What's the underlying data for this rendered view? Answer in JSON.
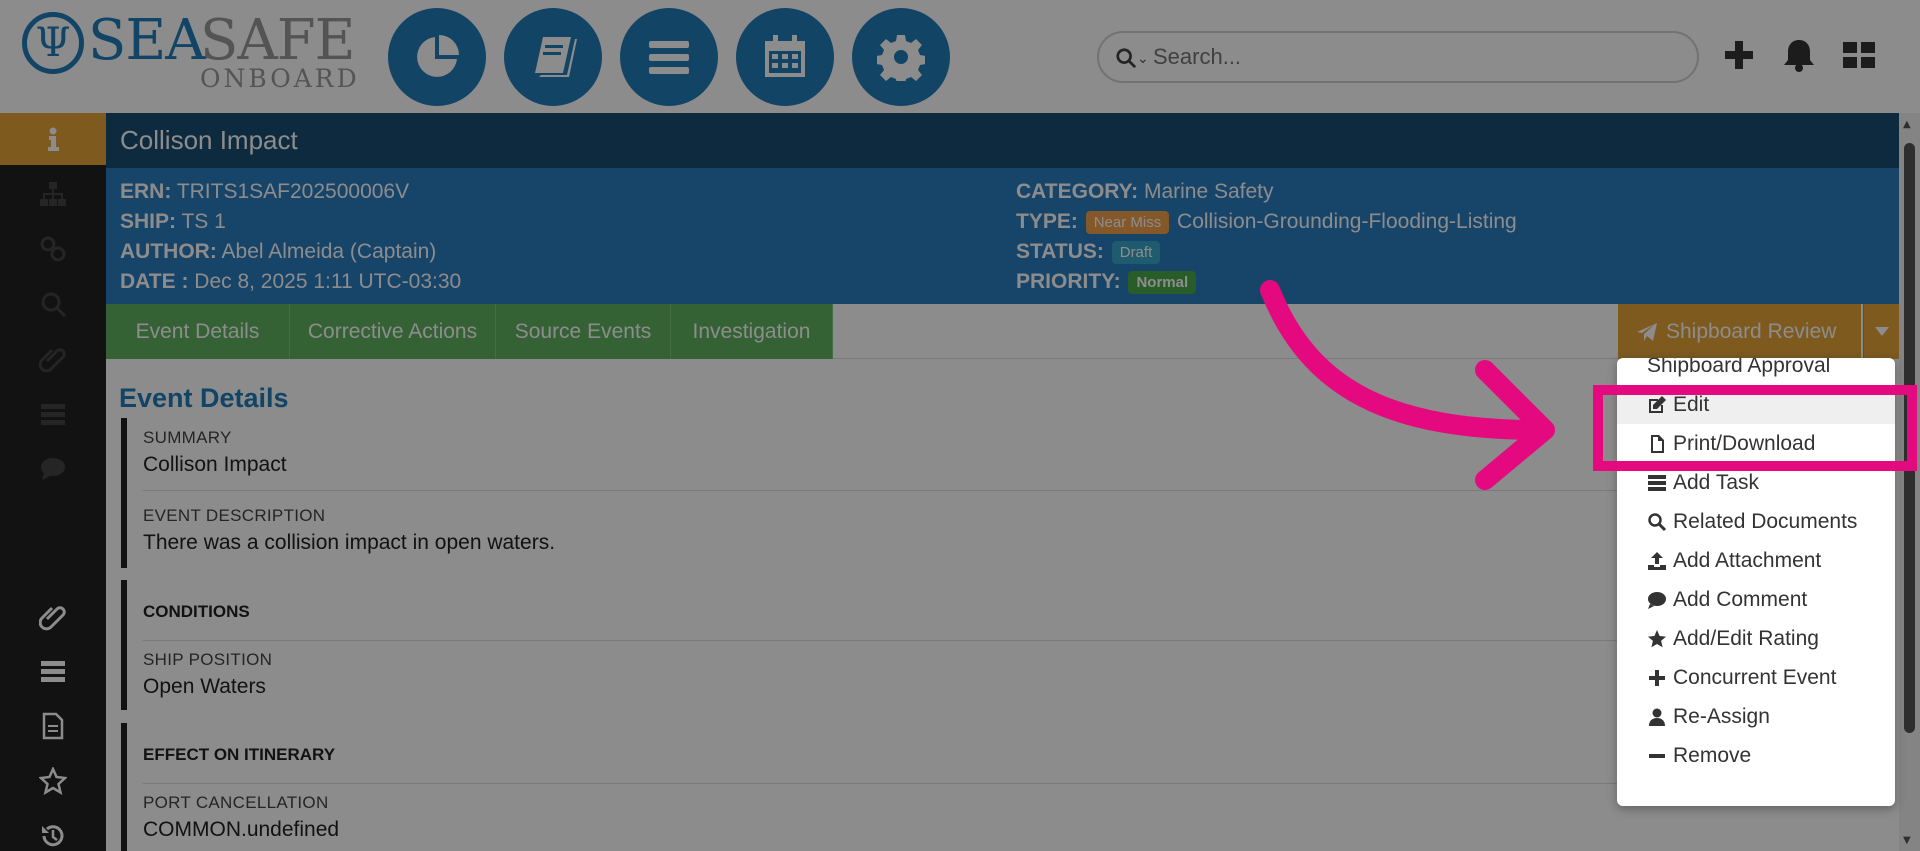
{
  "logo": {
    "sea": "SEA",
    "safe": "SAFE",
    "onboard": "ONBOARD"
  },
  "nav_buttons": [
    "dashboard-icon",
    "book-icon",
    "menu-icon",
    "calendar-icon",
    "gear-icon"
  ],
  "search": {
    "placeholder": "Search..."
  },
  "header_icons": [
    "plus-icon",
    "bell-icon",
    "grid-icon"
  ],
  "event": {
    "title": "Collison Impact",
    "ern_label": "ERN:",
    "ern": "TRITS1SAF202500006V",
    "ship_label": "SHIP:",
    "ship": "TS 1",
    "author_label": "AUTHOR:",
    "author": "Abel Almeida (Captain)",
    "date_label": "DATE :",
    "date": "Dec 8, 2025 1:11 UTC-03:30",
    "category_label": "CATEGORY:",
    "category": "Marine Safety",
    "type_label": "TYPE:",
    "type_badge": "Near Miss",
    "type": "Collision-Grounding-Flooding-Listing",
    "status_label": "STATUS:",
    "status_badge": "Draft",
    "priority_label": "PRIORITY:",
    "priority_badge": "Normal"
  },
  "tabs": [
    "Event Details",
    "Corrective Actions",
    "Source Events",
    "Investigation"
  ],
  "review_button": "Shipboard Review",
  "section": {
    "title": "Event Details",
    "summary_label": "SUMMARY",
    "summary": "Collison Impact",
    "description_label": "EVENT DESCRIPTION",
    "description": "There was a collision impact in open waters.",
    "conditions_heading": "CONDITIONS",
    "ship_position_label": "SHIP POSITION",
    "ship_position": "Open Waters",
    "itinerary_heading": "EFFECT ON ITINERARY",
    "port_cancellation_label": "PORT CANCELLATION",
    "port_cancellation": "COMMON.undefined"
  },
  "dropdown": {
    "items": [
      {
        "label": "Shipboard Approval",
        "icon": "none"
      },
      {
        "label": "Edit",
        "icon": "edit-icon"
      },
      {
        "label": "Print/Download",
        "icon": "file-icon"
      },
      {
        "label": "Add Task",
        "icon": "tasks-icon"
      },
      {
        "label": "Related Documents",
        "icon": "search-icon"
      },
      {
        "label": "Add Attachment",
        "icon": "upload-icon"
      },
      {
        "label": "Add Comment",
        "icon": "comment-icon"
      },
      {
        "label": "Add/Edit Rating",
        "icon": "star-icon"
      },
      {
        "label": "Concurrent Event",
        "icon": "plus-icon"
      },
      {
        "label": "Re-Assign",
        "icon": "user-icon"
      },
      {
        "label": "Remove",
        "icon": "minus-icon"
      }
    ]
  },
  "colors": {
    "brand": "#1f7db8",
    "accent": "#e6a43a",
    "highlight": "#e5097f",
    "tab_green": "#5fb35f"
  }
}
